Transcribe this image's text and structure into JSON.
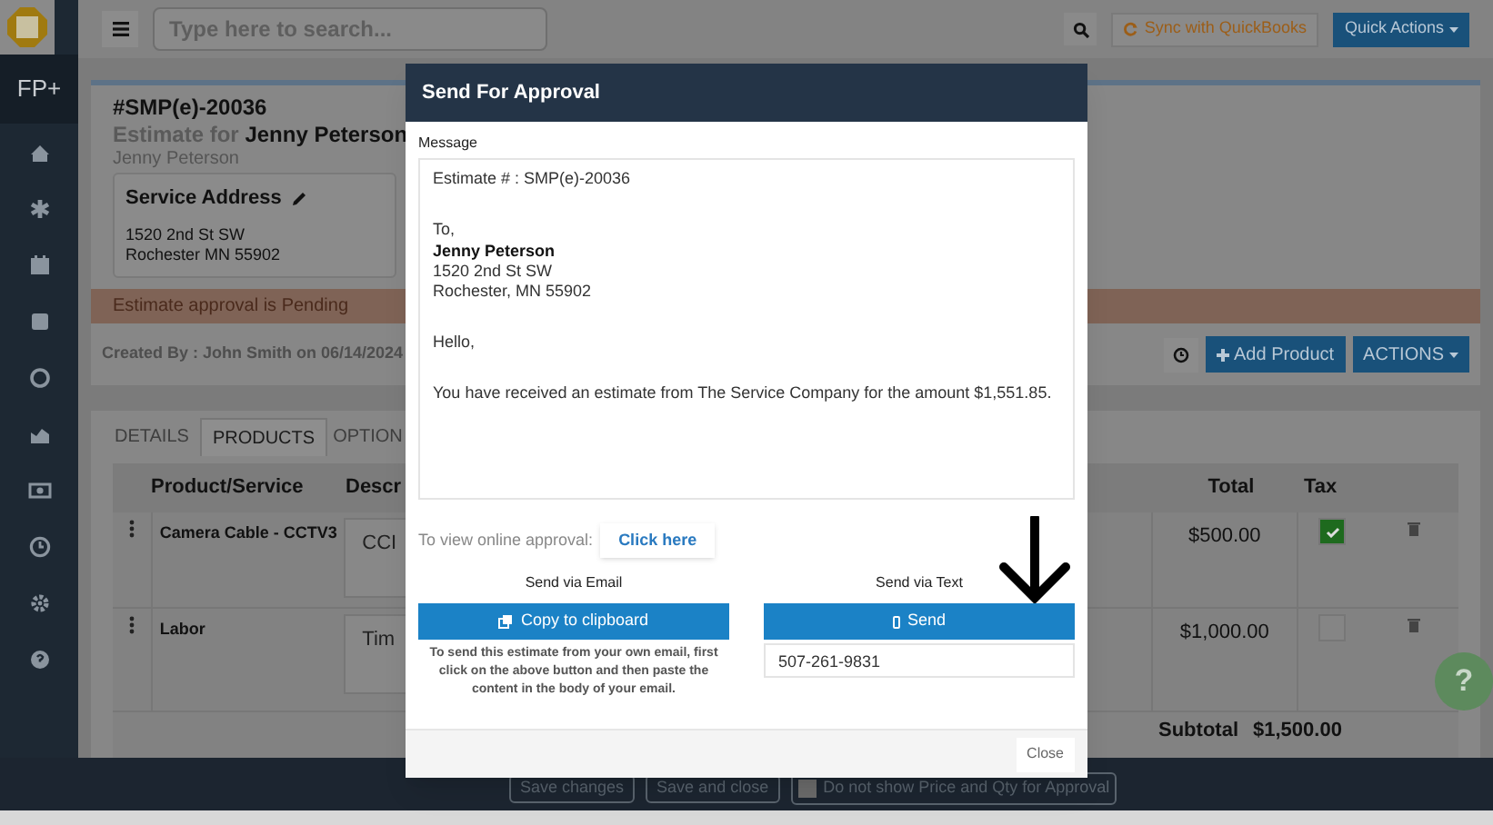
{
  "header": {
    "search_placeholder": "Type here to search...",
    "sync_button": "Sync with QuickBooks",
    "quick_actions": "Quick Actions"
  },
  "sidebar": {
    "brand": "FP+"
  },
  "estimate": {
    "number": "#SMP(e)-20036",
    "title": "Estimate for **Jenny Peterson**",
    "subtitle": "Jenny Peterson",
    "address_heading": "Service Address",
    "address_lines": [
      "1520 2nd St SW",
      "Rochester MN 55902"
    ],
    "status_banner": "Estimate approval is Pending",
    "created_by": "Created By : John Smith on 06/14/2024",
    "add_product": "Add Product",
    "actions": "ACTIONS"
  },
  "tabs": [
    {
      "label": "DETAILS",
      "selected": false
    },
    {
      "label": "PRODUCTS",
      "selected": true
    },
    {
      "label": "OPTION",
      "selected": false
    }
  ],
  "table": {
    "columns": [
      "Product/Service",
      "Descr",
      "Total",
      "Tax"
    ],
    "rows": [
      {
        "product": "Camera Cable - CCTV3",
        "description": "CCI",
        "total": "$500.00",
        "taxable": true
      },
      {
        "product": "Labor",
        "description": "Tim",
        "total": "$1,000.00",
        "taxable": false
      }
    ],
    "subtotal_label": "Subtotal",
    "subtotal": "$1,500.00"
  },
  "footer": {
    "buttons": [
      "Save changes",
      "Save and close"
    ],
    "option_label": "Do not show Price and Qty for Approval",
    "option_checked": false
  },
  "help_button": "?",
  "modal": {
    "title": "Send For Approval",
    "message_label": "Message",
    "message": [
      {
        "lines": [
          "Estimate # : SMP(e)-20036"
        ]
      },
      {
        "lines": [
          "To,"
        ],
        "name": "Jenny Peterson",
        "address": [
          "1520 2nd St SW",
          "Rochester, MN 55902"
        ]
      },
      {
        "lines": [
          "Hello,"
        ]
      },
      {
        "lines": [
          "You have received an estimate from The Service Company for the amount $1,551.85."
        ]
      }
    ],
    "online_label": "To view online approval:",
    "online_link": "Click here",
    "email": {
      "heading": "Send via Email",
      "button": "Copy to clipboard",
      "note": "To send this estimate from your own email, first click on the above button and then paste the content in the body of your email."
    },
    "text": {
      "heading": "Send via Text",
      "button": "Send",
      "phone": "507-261-9831"
    },
    "close": "Close"
  }
}
